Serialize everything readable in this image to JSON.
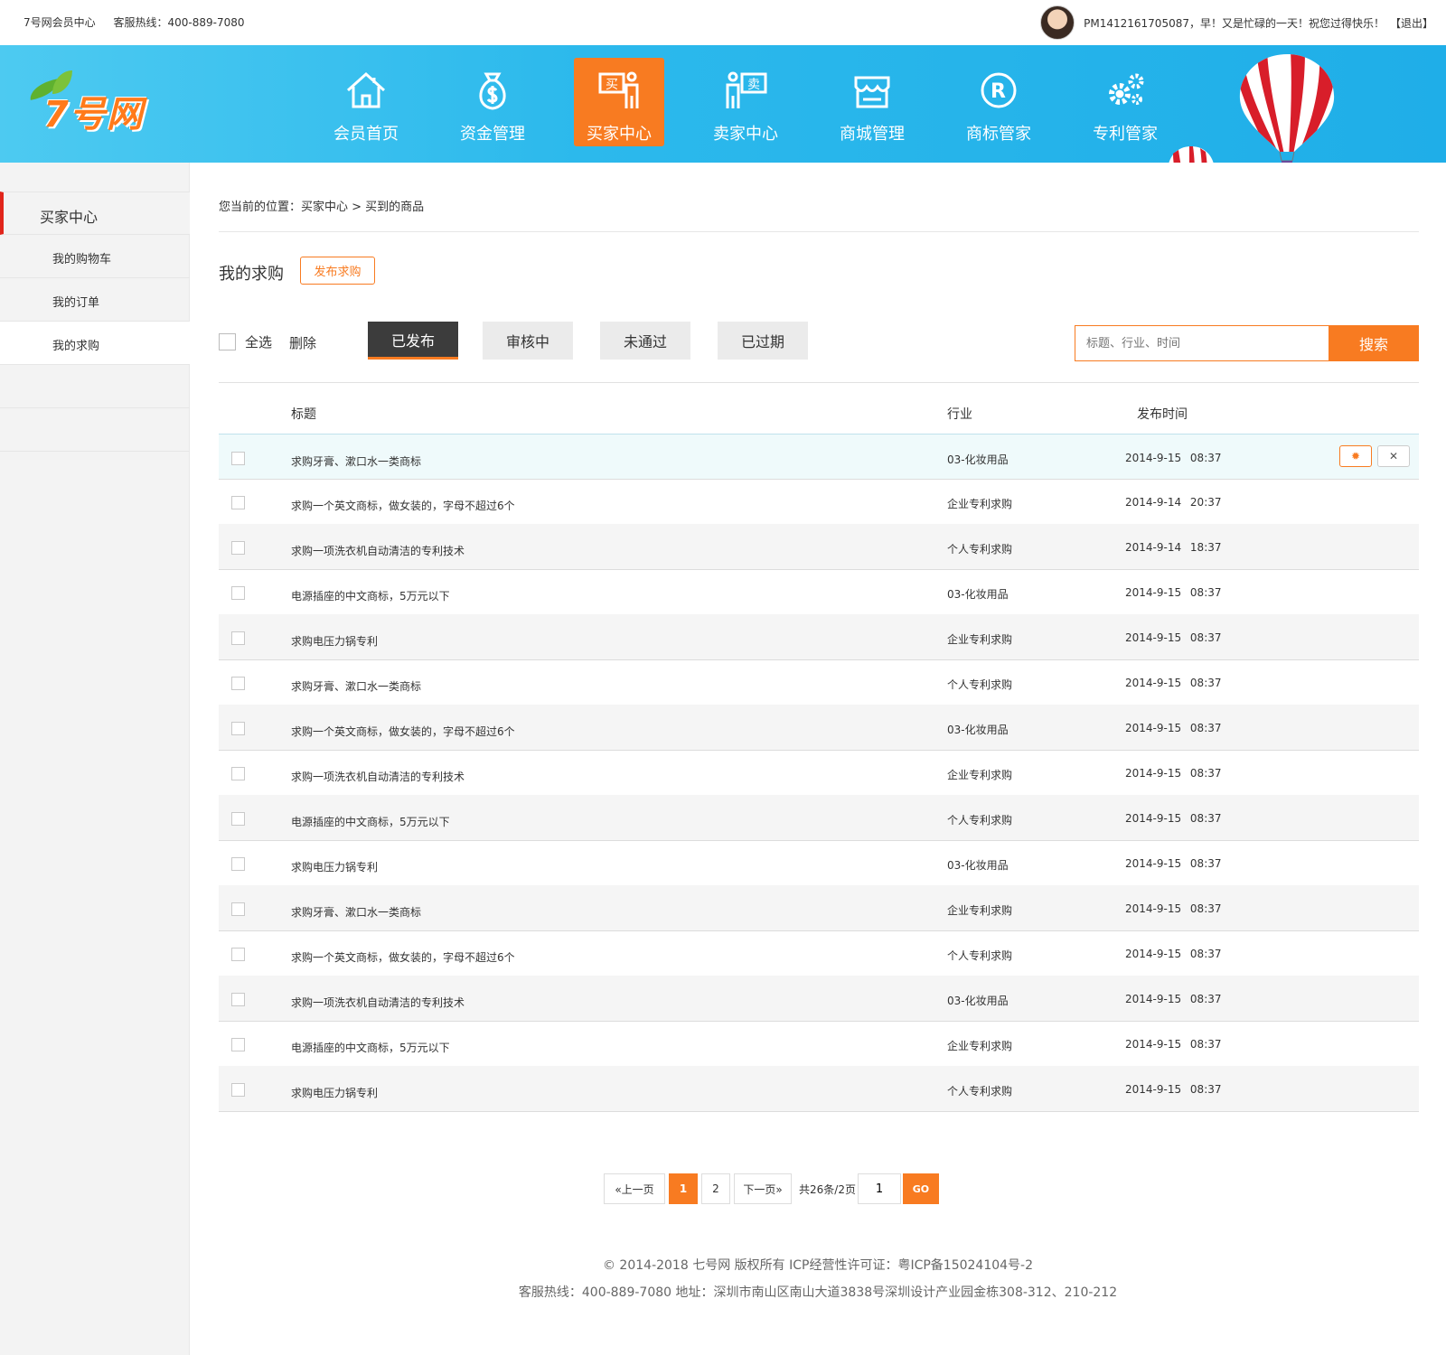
{
  "topbar": {
    "site_name": "7号网会员中心",
    "hotline": "客服热线：400-889-7080",
    "greeting": "PM1412161705087，早！又是忙碌的一天！祝您过得快乐！",
    "logout": "【退出】"
  },
  "header": {
    "logo_text": "7号网",
    "nav": [
      {
        "label": "会员首页",
        "icon": "home-icon"
      },
      {
        "label": "资金管理",
        "icon": "money-bag-icon"
      },
      {
        "label": "买家中心",
        "icon": "buyer-icon",
        "active": true
      },
      {
        "label": "卖家中心",
        "icon": "seller-icon"
      },
      {
        "label": "商城管理",
        "icon": "store-icon"
      },
      {
        "label": "商标管家",
        "icon": "registered-icon"
      },
      {
        "label": "专利管家",
        "icon": "gears-icon"
      }
    ],
    "buyer_badge": "买",
    "seller_badge": "卖",
    "registered_mark": "R"
  },
  "sidebar": {
    "title": "买家中心",
    "items": [
      {
        "label": "我的购物车"
      },
      {
        "label": "我的订单"
      },
      {
        "label": "我的求购",
        "active": true
      }
    ]
  },
  "main": {
    "breadcrumb": "您当前的位置：买家中心 > 买到的商品",
    "title": "我的求购",
    "publish_button": "发布求购",
    "select_all": "全选",
    "delete": "删除",
    "tabs": [
      "已发布",
      "审核中",
      "未通过",
      "已过期"
    ],
    "search_placeholder": "标题、行业、时间",
    "search_button": "搜索",
    "columns": {
      "title": "标题",
      "industry": "行业",
      "time": "发布时间"
    },
    "rows": [
      {
        "title": "求购牙膏、漱口水一类商标",
        "industry": "03-化妆用品",
        "time": "2014-9-15 08:37"
      },
      {
        "title": "求购一个英文商标，做女装的，字母不超过6个",
        "industry": "企业专利求购",
        "time": "2014-9-14 20:37"
      },
      {
        "title": "求购一项洗衣机自动清洁的专利技术",
        "industry": "个人专利求购",
        "time": "2014-9-14 18:37"
      },
      {
        "title": "电源插座的中文商标，5万元以下",
        "industry": "03-化妆用品",
        "time": "2014-9-15 08:37"
      },
      {
        "title": "求购电压力锅专利",
        "industry": "企业专利求购",
        "time": "2014-9-15 08:37"
      },
      {
        "title": "求购牙膏、漱口水一类商标",
        "industry": "个人专利求购",
        "time": "2014-9-15 08:37"
      },
      {
        "title": "求购一个英文商标，做女装的，字母不超过6个",
        "industry": "03-化妆用品",
        "time": "2014-9-15 08:37"
      },
      {
        "title": "求购一项洗衣机自动清洁的专利技术",
        "industry": "企业专利求购",
        "time": "2014-9-15 08:37"
      },
      {
        "title": "电源插座的中文商标，5万元以下",
        "industry": "个人专利求购",
        "time": "2014-9-15 08:37"
      },
      {
        "title": "求购电压力锅专利",
        "industry": "03-化妆用品",
        "time": "2014-9-15 08:37"
      },
      {
        "title": "求购牙膏、漱口水一类商标",
        "industry": "企业专利求购",
        "time": "2014-9-15 08:37"
      },
      {
        "title": "求购一个英文商标，做女装的，字母不超过6个",
        "industry": "个人专利求购",
        "time": "2014-9-15 08:37"
      },
      {
        "title": "求购一项洗衣机自动清洁的专利技术",
        "industry": "03-化妆用品",
        "time": "2014-9-15 08:37"
      },
      {
        "title": "电源插座的中文商标，5万元以下",
        "industry": "企业专利求购",
        "time": "2014-9-15 08:37"
      },
      {
        "title": "求购电压力锅专利",
        "industry": "个人专利求购",
        "time": "2014-9-15 08:37"
      }
    ],
    "row_actions": {
      "edit_icon": "gear-icon",
      "delete_icon": "close-icon",
      "delete_symbol": "✕",
      "edit_symbol": "✹"
    }
  },
  "pager": {
    "prev": "«上一页",
    "pages": [
      "1",
      "2"
    ],
    "current": "1",
    "next": "下一页»",
    "info": "共26条/2页",
    "jump_value": "1",
    "go": "GO"
  },
  "footer": {
    "line1": "© 2014-2018 七号网 版权所有 ICP经营性许可证：粤ICP备15024104号-2",
    "line2": "客服热线：400-889-7080  地址：深圳市南山区南山大道3838号深圳设计产业园金栋308-312、210-212"
  },
  "colors": {
    "accent": "#f87b21",
    "header_blue": "#1faee8",
    "sidebar_marker": "#e1251b"
  }
}
